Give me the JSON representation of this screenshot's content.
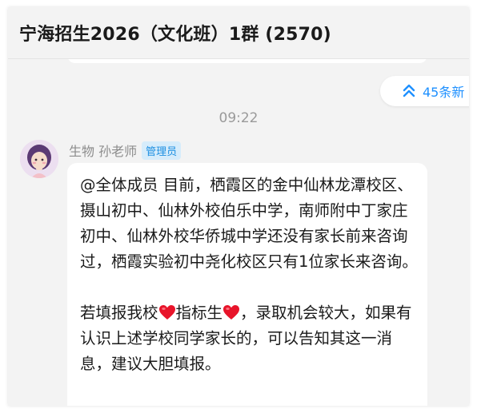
{
  "header": {
    "title": "宁海招生2026（文化班）1群 (2570)"
  },
  "new_messages": {
    "label": "45条新",
    "icon": "double-chevron-up-icon",
    "color": "#1e90ff"
  },
  "timestamp": "09:22",
  "message": {
    "sender": "生物 孙老师",
    "badge": "管理员",
    "paragraph1": "@全体成员 目前，栖霞区的金中仙林龙潭校区、摄山初中、仙林外校伯乐中学，南师附中丁家庄初中、仙林外校华侨城中学还没有家长前来咨询过，栖霞实验初中尧化校区只有1位家长来咨询。",
    "paragraph2_a": "若填报我校",
    "emoji_1": "heart-emoji",
    "paragraph2_b": "指标生",
    "emoji_2": "heart-emoji",
    "paragraph2_c": "，录取机会较大，如果有认识上述学校同学家长的，可以告知其这一消息，建议大胆填报。"
  },
  "colors": {
    "background": "#f3f3f3",
    "bubble": "#ffffff",
    "badge_bg": "#d6ecfb",
    "badge_text": "#1d8fe1",
    "heart": "#e8142a"
  }
}
